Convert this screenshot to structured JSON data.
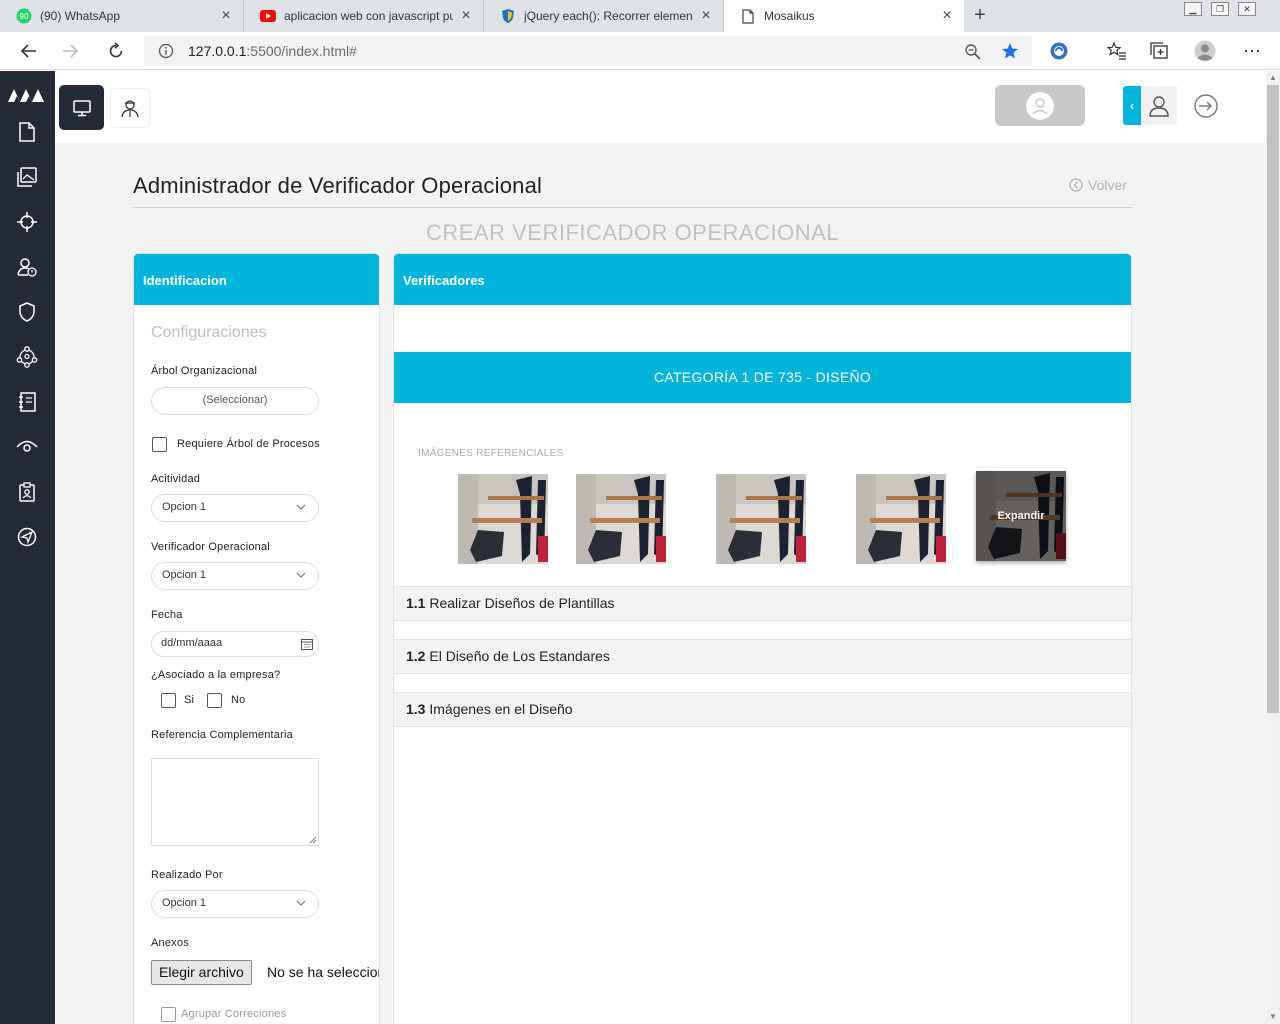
{
  "browser": {
    "tabs": [
      {
        "title": "(90) WhatsApp",
        "badge": "90",
        "favicon": "whatsapp-icon"
      },
      {
        "title": "aplicacion web con javascript pur",
        "favicon": "youtube-icon"
      },
      {
        "title": "jQuery each(): Recorrer elemento",
        "favicon": "shield-icon"
      },
      {
        "title": "Mosaikus",
        "favicon": "page-icon"
      }
    ],
    "url_host": "127.0.0.1",
    "url_rest": ":5500/index.html#"
  },
  "header": {
    "collapse_glyph": "‹"
  },
  "page": {
    "title": "Administrador de Verificador Operacional",
    "back_label": "Volver",
    "subtitle": "CREAR VERIFICADOR OPERACIONAL"
  },
  "left_panel": {
    "header": "Identificacion",
    "section": "Configuraciones",
    "org_tree_label": "Árbol Organizacional",
    "org_tree_button": "(Seleccionar)",
    "process_tree_checkbox": "Requiere Árbol de Procesos",
    "activity_label": "Acitividad",
    "activity_value": "Opcion 1",
    "verifier_label": "Verificador Operacional",
    "verifier_value": "Opcion 1",
    "date_label": "Fecha",
    "date_placeholder": "dd/mm/aaaa",
    "associated_label": "¿Asociado a la empresa?",
    "yes_label": "Si",
    "no_label": "No",
    "reference_label": "Referencia Complementaria",
    "done_by_label": "Realizado Por",
    "done_by_value": "Opcion 1",
    "attachments_label": "Anexos",
    "file_button": "Elegir archivo",
    "file_status": "No se ha seleccion",
    "group_corrections": "Agrupar Correciones"
  },
  "right_panel": {
    "header": "Verificadores",
    "category_bar": "CATEGORÍA 1 DE 735 - DISEÑO",
    "images_label": "IMÁGENES REFERENCIALES",
    "expand_label": "Expandir",
    "items": [
      {
        "num": "1.1",
        "text": "Realizar Diseños de Plantillas"
      },
      {
        "num": "1.2",
        "text": "El Diseño de Los Estandares"
      },
      {
        "num": "1.3",
        "text": "Imágenes en el Diseño"
      }
    ]
  },
  "colors": {
    "accent": "#00b4dc",
    "sidebar": "#252b36",
    "background": "#f3f3f4"
  }
}
